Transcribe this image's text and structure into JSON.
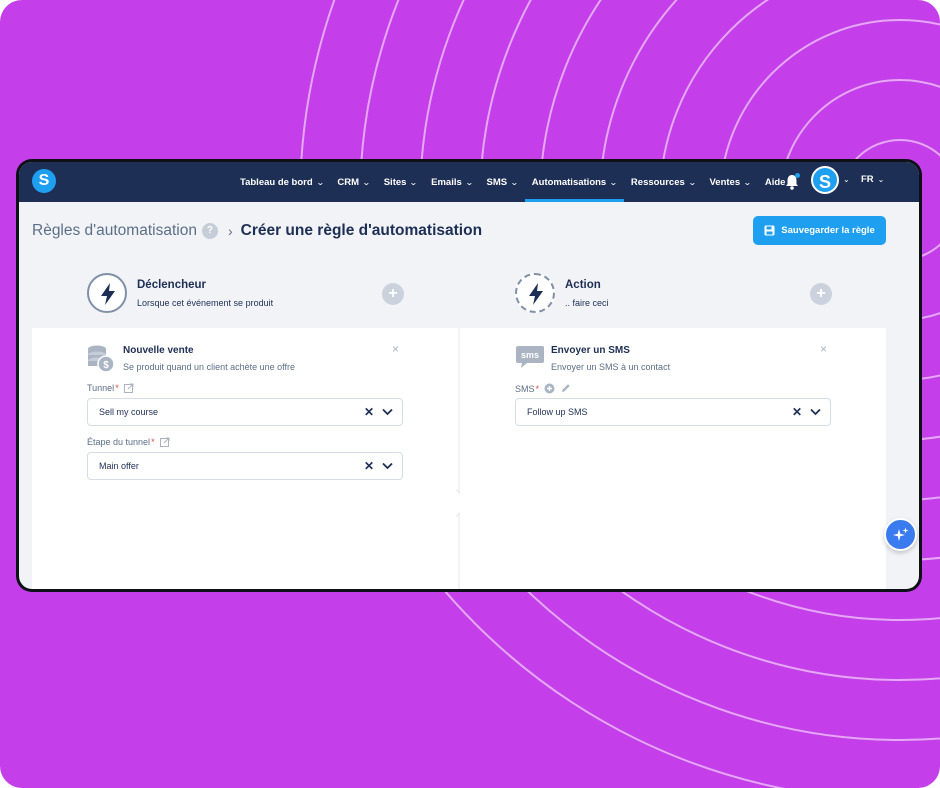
{
  "colors": {
    "background": "#c43fe9",
    "nav": "#1e2f55",
    "accent": "#1f9ff0",
    "text_dark": "#1e2f55",
    "text_muted": "#5c6f88",
    "required": "#e2494a"
  },
  "app": {
    "logo_letter": "S"
  },
  "nav": {
    "items": [
      {
        "label": "Tableau de bord",
        "has_dropdown": true
      },
      {
        "label": "CRM",
        "has_dropdown": true
      },
      {
        "label": "Sites",
        "has_dropdown": true
      },
      {
        "label": "Emails",
        "has_dropdown": true
      },
      {
        "label": "SMS",
        "has_dropdown": true
      },
      {
        "label": "Automatisations",
        "has_dropdown": true,
        "active": true
      },
      {
        "label": "Ressources",
        "has_dropdown": true
      },
      {
        "label": "Ventes",
        "has_dropdown": true
      },
      {
        "label": "Aide",
        "has_dropdown": false
      }
    ],
    "avatar_letter": "S",
    "language": "FR",
    "icons": [
      "bell-icon",
      "chevron-down-icon"
    ]
  },
  "page": {
    "breadcrumb_parent": "Règles d'automatisation",
    "breadcrumb_current": "Créer une règle d'automatisation",
    "help_symbol": "?",
    "save_button": "Sauvegarder la règle"
  },
  "trigger": {
    "title": "Déclencheur",
    "subtitle": "Lorsque cet événement se produit",
    "card_title": "Nouvelle vente",
    "card_subtitle": "Se produit quand un client achète une offre",
    "fields": [
      {
        "label": "Tunnel",
        "required": true,
        "value": "Sell my course"
      },
      {
        "label": "Étape du tunnel",
        "required": true,
        "value": "Main offer"
      }
    ]
  },
  "action": {
    "title": "Action",
    "subtitle": ".. faire ceci",
    "card_title": "Envoyer un SMS",
    "card_subtitle": "Envoyer un SMS à un contact",
    "icon_text": "sms",
    "fields": [
      {
        "label": "SMS",
        "required": true,
        "value": "Follow up SMS"
      }
    ]
  },
  "symbols": {
    "required_mark": "*",
    "plus": "+",
    "close": "×",
    "clear": "✕"
  }
}
